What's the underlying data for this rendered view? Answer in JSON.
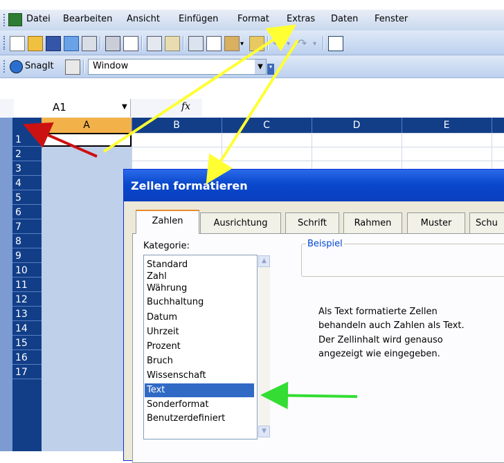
{
  "menu": {
    "items": [
      "Datei",
      "Bearbeiten",
      "Ansicht",
      "Einfügen",
      "Format",
      "Extras",
      "Daten",
      "Fenster"
    ]
  },
  "snagit": {
    "label": "SnagIt",
    "window_value": "Window"
  },
  "formula": {
    "cell_ref": "A1",
    "fx": "fx"
  },
  "grid": {
    "columns": [
      "A",
      "B",
      "C",
      "D",
      "E"
    ],
    "rows": [
      "1",
      "2",
      "3",
      "4",
      "5",
      "6",
      "7",
      "8",
      "9",
      "10",
      "11",
      "12",
      "13",
      "14",
      "15",
      "16",
      "17"
    ]
  },
  "dialog": {
    "title": "Zellen formatieren",
    "tabs": [
      "Zahlen",
      "Ausrichtung",
      "Schrift",
      "Rahmen",
      "Muster",
      "Schu"
    ],
    "category_label": "Kategorie:",
    "categories": [
      "Standard",
      "Zahl",
      "Währung",
      "Buchhaltung",
      "Datum",
      "Uhrzeit",
      "Prozent",
      "Bruch",
      "Wissenschaft",
      "Text",
      "Sonderformat",
      "Benutzerdefiniert"
    ],
    "selected_category": "Text",
    "sample_label": "Beispiel",
    "description": [
      "Als Text formatierte Zellen",
      "behandeln auch Zahlen als Text.",
      "Der Zellinhalt wird genauso",
      "angezeigt wie eingegeben."
    ]
  },
  "colors": {
    "title_bar": "#0a48cc",
    "header_blue": "#123e88",
    "arrow_yellow": "#ffff33",
    "arrow_red": "#cc1111",
    "arrow_green": "#33dd33"
  }
}
